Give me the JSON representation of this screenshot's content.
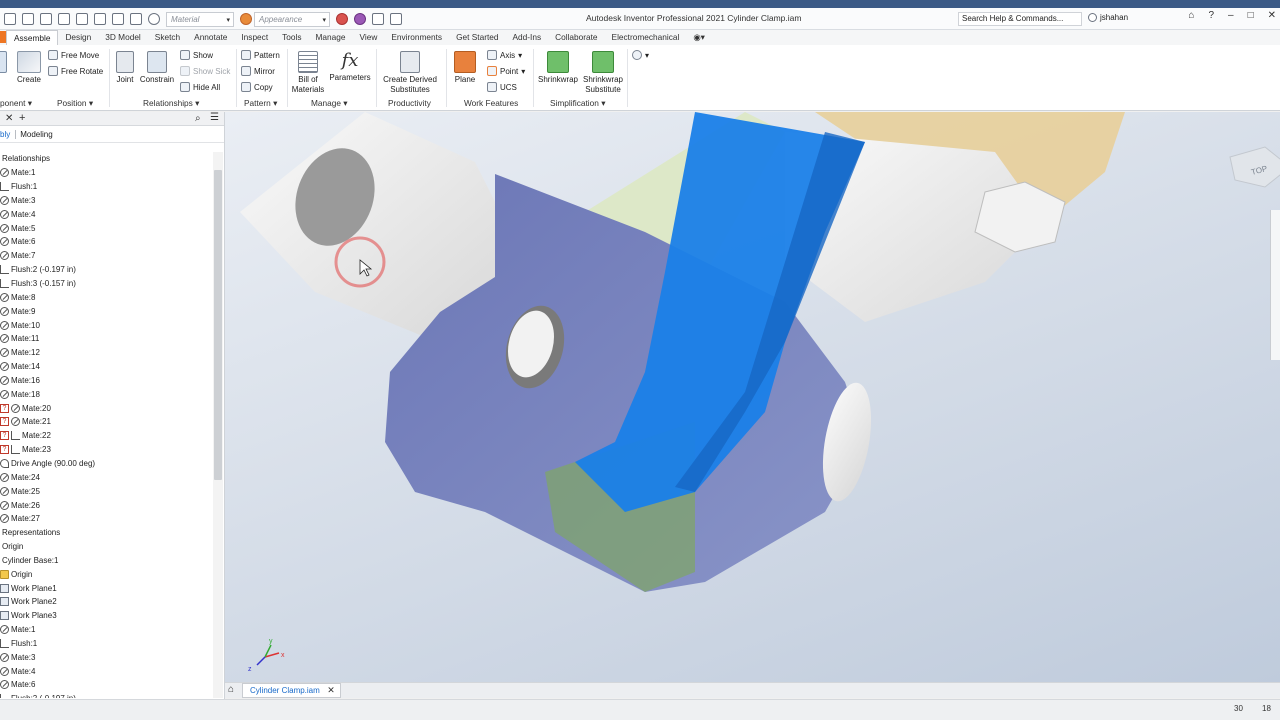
{
  "titlebar": {
    "app_title": "Autodesk Inventor Professional 2021   Cylinder Clamp.iam",
    "material_placeholder": "Material",
    "appearance_placeholder": "Appearance",
    "search_text": "Search Help & Commands...",
    "user": "jshahan",
    "accent": "#3b5a86"
  },
  "tabs": [
    "Assemble",
    "Design",
    "3D Model",
    "Sketch",
    "Annotate",
    "Inspect",
    "Tools",
    "Manage",
    "View",
    "Environments",
    "Get Started",
    "Add-Ins",
    "Collaborate",
    "Electromechanical"
  ],
  "ribbon": {
    "create": "Create",
    "free_move": "Free Move",
    "free_rotate": "Free Rotate",
    "joint": "Joint",
    "constrain": "Constrain",
    "show": "Show",
    "show_sick": "Show Sick",
    "hide_all": "Hide All",
    "pattern": "Pattern",
    "mirror": "Mirror",
    "copy": "Copy",
    "bom_1": "Bill of",
    "bom_2": "Materials",
    "parameters": "Parameters",
    "create_derived_1": "Create Derived",
    "create_derived_2": "Substitutes",
    "plane": "Plane",
    "axis": "Axis",
    "point": "Point",
    "ucs": "UCS",
    "shrinkwrap": "Shrinkwrap",
    "shrinkwrap_sub_1": "Shrinkwrap",
    "shrinkwrap_sub_2": "Substitute",
    "panels": {
      "component": "ponent",
      "position": "Position",
      "relationships": "Relationships",
      "pattern": "Pattern",
      "manage": "Manage",
      "productivity": "Productivity",
      "work_features": "Work Features",
      "simplification": "Simplification"
    }
  },
  "browser": {
    "mode_1": "bly",
    "mode_2": "Modeling",
    "tree": [
      {
        "label": "Relationships",
        "icon": "none"
      },
      {
        "label": "Mate:1",
        "icon": "mate"
      },
      {
        "label": "Flush:1",
        "icon": "flush"
      },
      {
        "label": "Mate:3",
        "icon": "mate"
      },
      {
        "label": "Mate:4",
        "icon": "mate"
      },
      {
        "label": "Mate:5",
        "icon": "mate"
      },
      {
        "label": "Mate:6",
        "icon": "mate"
      },
      {
        "label": "Mate:7",
        "icon": "mate"
      },
      {
        "label": "Flush:2 (-0.197 in)",
        "icon": "flush"
      },
      {
        "label": "Flush:3 (-0.157 in)",
        "icon": "flush"
      },
      {
        "label": "Mate:8",
        "icon": "mate"
      },
      {
        "label": "Mate:9",
        "icon": "mate"
      },
      {
        "label": "Mate:10",
        "icon": "mate"
      },
      {
        "label": "Mate:11",
        "icon": "mate"
      },
      {
        "label": "Mate:12",
        "icon": "mate"
      },
      {
        "label": "Mate:14",
        "icon": "mate"
      },
      {
        "label": "Mate:16",
        "icon": "mate"
      },
      {
        "label": "Mate:18",
        "icon": "mate"
      },
      {
        "label": "Mate:20",
        "icon": "warn-mate"
      },
      {
        "label": "Mate:21",
        "icon": "warn-mate"
      },
      {
        "label": "Mate:22",
        "icon": "warn-flush"
      },
      {
        "label": "Mate:23",
        "icon": "warn-flush"
      },
      {
        "label": "Drive Angle (90.00 deg)",
        "icon": "drive"
      },
      {
        "label": "Mate:24",
        "icon": "mate"
      },
      {
        "label": "Mate:25",
        "icon": "mate"
      },
      {
        "label": "Mate:26",
        "icon": "mate"
      },
      {
        "label": "Mate:27",
        "icon": "mate"
      },
      {
        "label": "Representations",
        "icon": "none"
      },
      {
        "label": "Origin",
        "icon": "none"
      },
      {
        "label": "Cylinder Base:1",
        "icon": "none"
      },
      {
        "label": "Origin",
        "icon": "folder"
      },
      {
        "label": "Work Plane1",
        "icon": "plane"
      },
      {
        "label": "Work Plane2",
        "icon": "plane"
      },
      {
        "label": "Work Plane3",
        "icon": "plane"
      },
      {
        "label": "Mate:1",
        "icon": "mate"
      },
      {
        "label": "Flush:1",
        "icon": "flush"
      },
      {
        "label": "Mate:3",
        "icon": "mate"
      },
      {
        "label": "Mate:4",
        "icon": "mate"
      },
      {
        "label": "Mate:6",
        "icon": "mate"
      },
      {
        "label": "Flush:2 (-0.197 in)",
        "icon": "flush"
      }
    ]
  },
  "viewcube_label": "TOP",
  "triad": {
    "x": "x",
    "y": "y",
    "z": "z"
  },
  "doc_tab": "Cylinder Clamp.iam",
  "status": {
    "value_a": "30",
    "value_b": "18"
  }
}
